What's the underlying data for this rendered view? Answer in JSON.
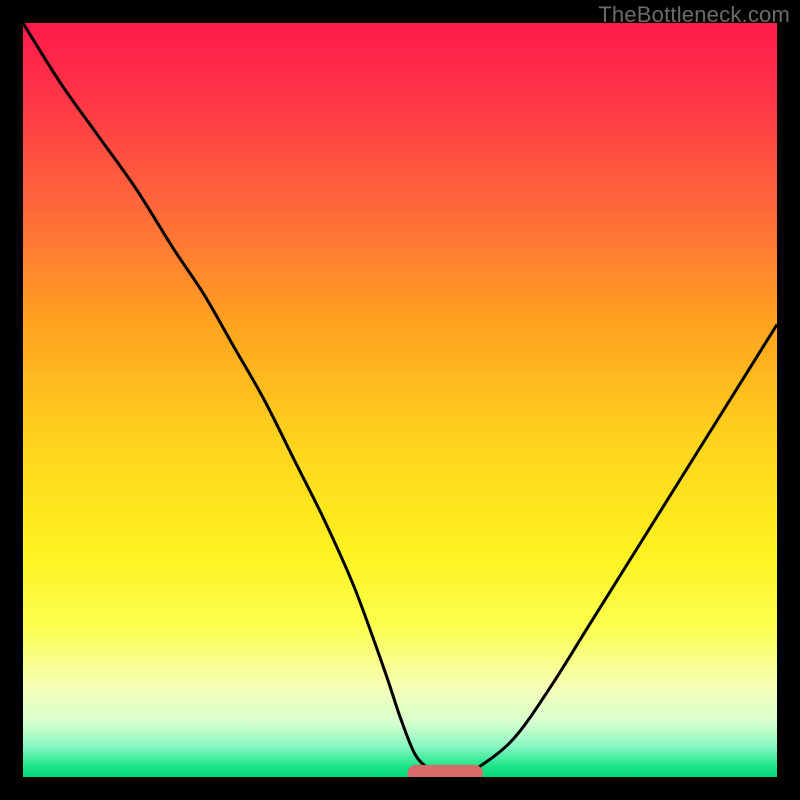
{
  "watermark": "TheBottleneck.com",
  "chart_data": {
    "type": "line",
    "title": "",
    "xlabel": "",
    "ylabel": "",
    "xlim": [
      0,
      100
    ],
    "ylim": [
      0,
      100
    ],
    "grid": false,
    "legend": false,
    "axes_visible": false,
    "background": {
      "type": "vertical-gradient",
      "stops": [
        {
          "offset": 0.0,
          "color": "#ff1a4b"
        },
        {
          "offset": 0.1,
          "color": "#ff3546"
        },
        {
          "offset": 0.25,
          "color": "#ff6a3a"
        },
        {
          "offset": 0.4,
          "color": "#ffa31f"
        },
        {
          "offset": 0.55,
          "color": "#ffd21d"
        },
        {
          "offset": 0.7,
          "color": "#fef220"
        },
        {
          "offset": 0.8,
          "color": "#fbff4e"
        },
        {
          "offset": 0.88,
          "color": "#f6ffb6"
        },
        {
          "offset": 0.93,
          "color": "#d4ffd0"
        },
        {
          "offset": 0.96,
          "color": "#86f6c0"
        },
        {
          "offset": 0.985,
          "color": "#1fe68a"
        },
        {
          "offset": 1.0,
          "color": "#00d877"
        }
      ]
    },
    "series": [
      {
        "name": "bottleneck-curve",
        "color": "#000000",
        "stroke_width": 3,
        "x": [
          0,
          5,
          10,
          15,
          20,
          24,
          28,
          32,
          36,
          40,
          44,
          48,
          50,
          52,
          54,
          56,
          58,
          60,
          65,
          70,
          75,
          80,
          85,
          90,
          95,
          100
        ],
        "y": [
          100,
          92,
          85,
          78,
          70,
          64,
          57,
          50,
          42,
          34,
          25,
          14,
          8,
          3,
          1,
          0,
          0,
          1,
          5,
          12,
          20,
          28,
          36,
          44,
          52,
          60
        ]
      }
    ],
    "marker": {
      "name": "optimal-range",
      "shape": "rounded-bar",
      "color": "#d96a6a",
      "x_start": 51,
      "x_end": 61,
      "y": 0.5,
      "height": 2.2
    }
  }
}
